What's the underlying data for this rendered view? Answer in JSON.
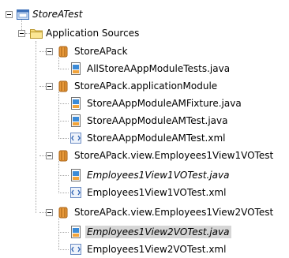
{
  "tree": {
    "root": {
      "label": "StoreATest"
    },
    "sources": {
      "label": "Application Sources"
    },
    "pkg1": {
      "label": "StoreAPack",
      "files": [
        "AllStoreAAppModuleTests.java"
      ]
    },
    "pkg2": {
      "label": "StoreAPack.applicationModule",
      "files": [
        "StoreAAppModuleAMFixture.java",
        "StoreAAppModuleAMTest.java",
        "StoreAAppModuleAMTest.xml"
      ]
    },
    "pkg3": {
      "label": "StoreAPack.view.Employees1View1VOTest",
      "files": [
        "Employees1View1VOTest.java",
        "Employees1View1VOTest.xml"
      ]
    },
    "pkg4": {
      "label": "StoreAPack.view.Employees1View2VOTest",
      "files": [
        "Employees1View2VOTest.java",
        "Employees1View2VOTest.xml"
      ]
    }
  }
}
